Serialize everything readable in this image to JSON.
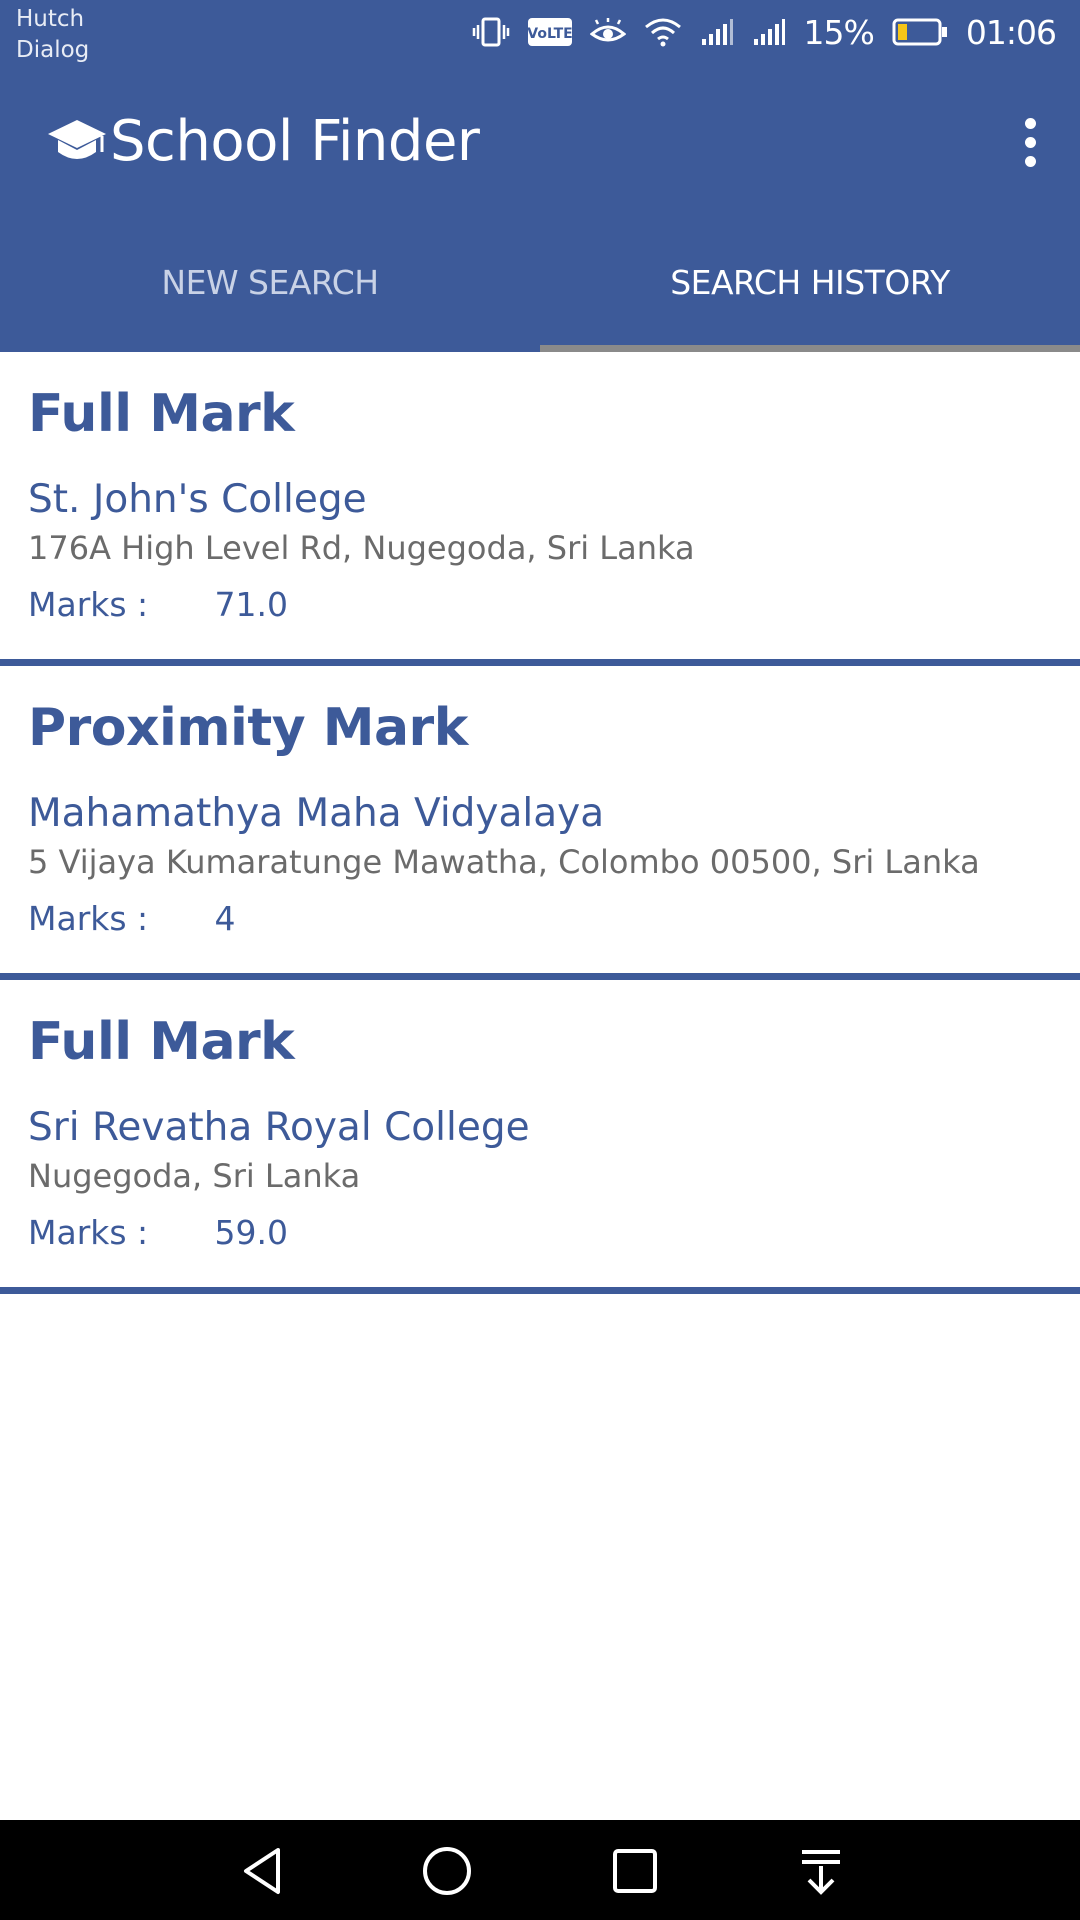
{
  "status_bar": {
    "carrier_1": "Hutch",
    "carrier_2": "Dialog",
    "battery_percent": "15%",
    "time": "01:06",
    "icons": [
      "vibrate-icon",
      "volte-icon",
      "eye-comfort-icon",
      "wifi-icon",
      "signal-icon",
      "signal-icon",
      "battery-icon"
    ]
  },
  "app_bar": {
    "title": "School Finder",
    "logo_icon": "graduation-cap-icon",
    "menu_icon": "more-vert-icon"
  },
  "tabs": [
    {
      "label": "NEW SEARCH",
      "active": false
    },
    {
      "label": "SEARCH HISTORY",
      "active": true
    }
  ],
  "history": [
    {
      "title": "Full Mark",
      "school": "St. John's College",
      "address": "176A High Level Rd, Nugegoda, Sri Lanka",
      "marks_label": "Marks :",
      "marks_value": "71.0"
    },
    {
      "title": "Proximity Mark",
      "school": "Mahamathya Maha Vidyalaya",
      "address": "5 Vijaya Kumaratunge Mawatha, Colombo 00500, Sri Lanka",
      "marks_label": "Marks :",
      "marks_value": "4"
    },
    {
      "title": "Full Mark",
      "school": "Sri Revatha Royal College",
      "address": "Nugegoda, Sri Lanka",
      "marks_label": "Marks :",
      "marks_value": "59.0"
    }
  ],
  "nav_bar": {
    "icons": [
      "back-icon",
      "home-icon",
      "recents-icon",
      "notification-pull-icon"
    ]
  },
  "colors": {
    "primary": "#3d5a99",
    "address_text": "#6b6b6b",
    "tab_indicator": "#8a8a8a"
  }
}
